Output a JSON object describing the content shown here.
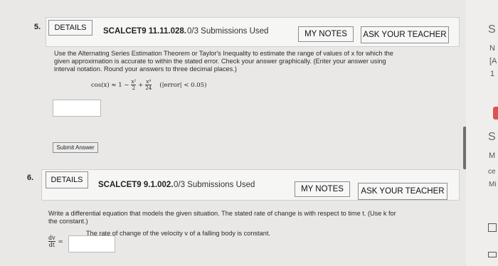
{
  "question5": {
    "number": "5.",
    "details_label": "DETAILS",
    "code": "SCALCET9 11.11.028.",
    "submissions": "0/3 Submissions Used",
    "my_notes_label": "MY NOTES",
    "ask_teacher_label": "ASK YOUR TEACHER",
    "instructions_line1": "Use the Alternating Series Estimation Theorem or Taylor's Inequality to estimate the range of values of x for which the",
    "instructions_line2": "given approximation is accurate to within the stated error. Check your answer graphically. (Enter your answer using",
    "instructions_line3": "interval notation. Round your answers to three decimal places.)",
    "formula_lhs": "cos(x) ≈ 1 −",
    "term2_num": "x²",
    "term2_den": "2",
    "plus": "+",
    "term3_num": "x⁴",
    "term3_den": "24",
    "error_condition": "(|error| < 0.05)",
    "answer_value": "",
    "submit_label": "Submit Answer"
  },
  "question6": {
    "number": "6.",
    "details_label": "DETAILS",
    "code": "SCALCET9 9.1.002.",
    "submissions": "0/3 Submissions Used",
    "my_notes_label": "MY NOTES",
    "ask_teacher_label": "ASK YOUR TEACHER",
    "instructions_line1": "Write a differential equation that models the given situation. The stated rate of change is with respect to time t. (Use k for",
    "instructions_line2": "the constant.)",
    "statement": "The rate of change of the velocity v of a falling body is constant.",
    "dv": "dv",
    "dt": "dt",
    "equals": "=",
    "answer_value": ""
  },
  "right_column": {
    "items": [
      "S",
      "N",
      "[A",
      "1",
      "S",
      "M",
      "ce",
      "Mi"
    ],
    "accent_color": "#d9534f"
  }
}
